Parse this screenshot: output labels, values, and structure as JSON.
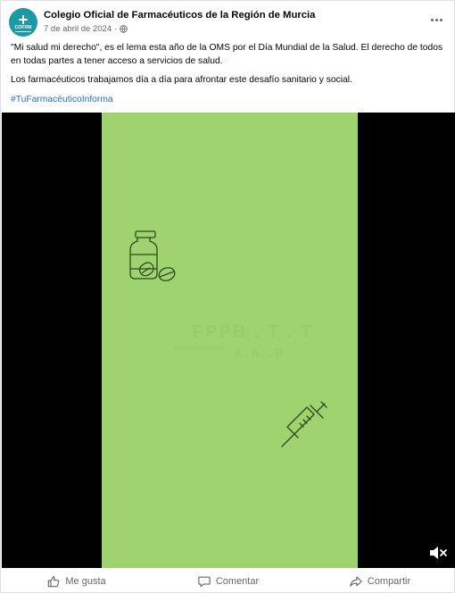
{
  "post": {
    "page_name": "Colegio Oficial de Farmacéuticos de la Región de Murcia",
    "date": "7 de abril de 2024",
    "separator": "·",
    "avatar_abbr": "COFRM",
    "paragraph_1": "\"Mi salud mi derecho\", es el lema esta año de la OMS por el Día Mundial de la Salud. El derecho de todos en todas partes a tener acceso a servicios de salud.",
    "paragraph_2": "Los farmacéuticos trabajamos día a día para afrontar este desafío sanitario y social.",
    "hashtag": "#TuFarmacéuticoInforma"
  },
  "video": {
    "ghost_title": "FPPB . T . T",
    "ghost_sub": "A . A . . B",
    "frame_color": "#9fd36f",
    "icons": [
      "medicine-bottle-icon",
      "syringe-icon",
      "volume-mute-icon"
    ]
  },
  "actions": {
    "like_label": "Me gusta",
    "comment_label": "Comentar",
    "share_label": "Compartir"
  },
  "colors": {
    "brand_avatar": "#1b9aa3",
    "hashtag": "#216fdb",
    "muted_text": "#65676b"
  }
}
